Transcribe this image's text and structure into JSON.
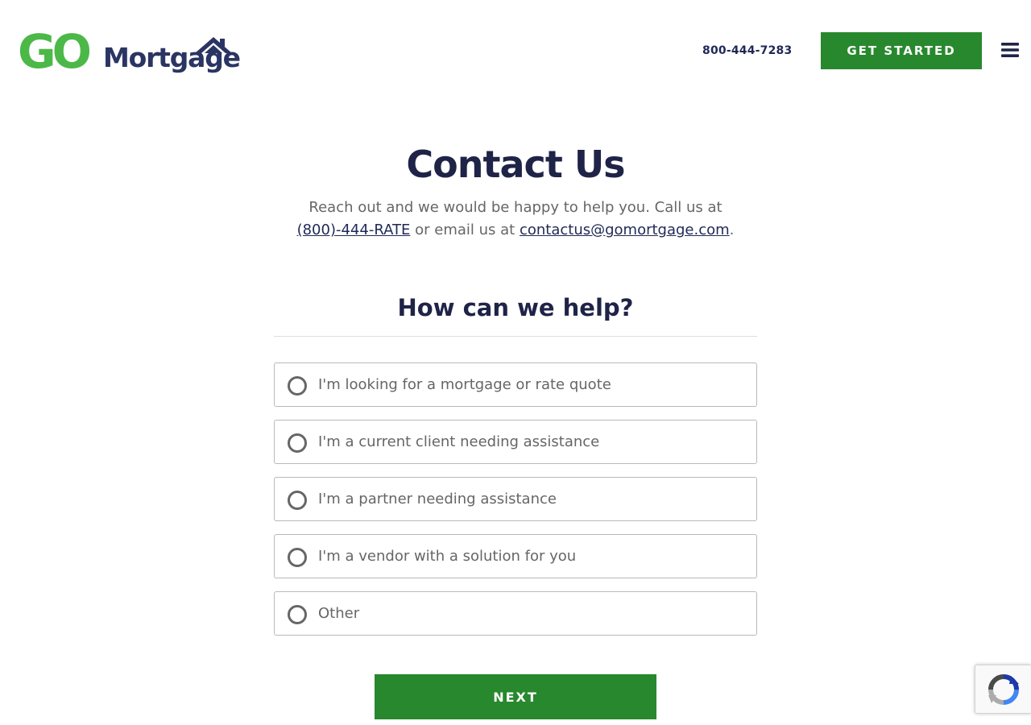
{
  "header": {
    "logo": {
      "go_text": "GO",
      "mortgage_text": "Mortgage"
    },
    "phone": "800-444-7283",
    "cta_label": "GET STARTED",
    "menu_icon": "hamburger-menu-icon"
  },
  "main": {
    "title": "Contact Us",
    "intro": {
      "text_before": "Reach out and we would be happy to help you. Call us at",
      "phone_link": "(800)-444-RATE",
      "text_middle": "or email us at",
      "email_link": "contactus@gomortgage.com",
      "text_after": "."
    },
    "help_title": "How can we help?",
    "options": [
      {
        "label": "I'm looking for a mortgage or rate quote",
        "selected": false
      },
      {
        "label": "I'm a current client needing assistance",
        "selected": false
      },
      {
        "label": "I'm a partner needing assistance",
        "selected": false
      },
      {
        "label": "I'm a vendor with a solution for you",
        "selected": false
      },
      {
        "label": "Other",
        "selected": false
      }
    ],
    "next_label": "NEXT"
  },
  "recaptcha": {
    "icon": "recaptcha-icon"
  },
  "colors": {
    "brand_green": "#4cb848",
    "button_green": "#28882e",
    "navy": "#1f2347",
    "text_gray": "#666666",
    "border_gray": "#b9b9b9"
  }
}
